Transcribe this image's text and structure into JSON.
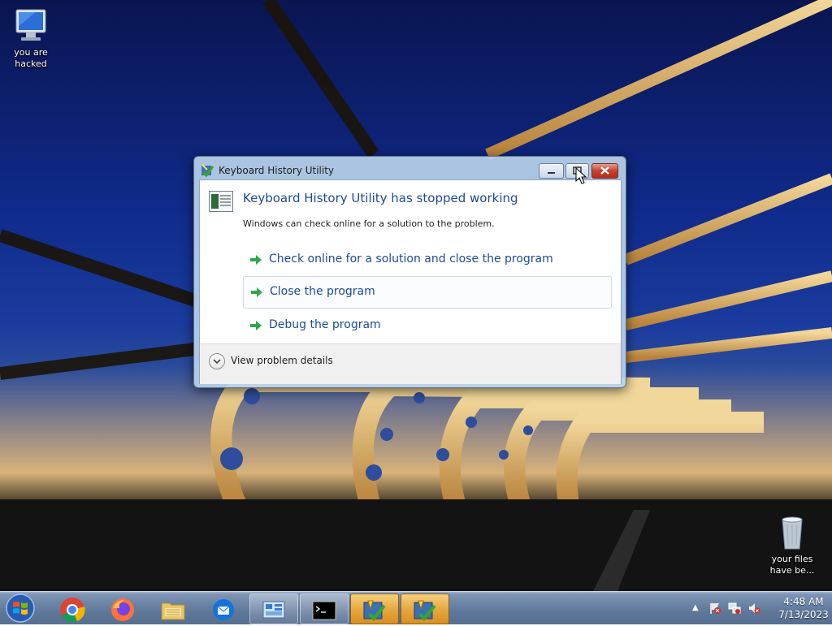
{
  "desktop": {
    "icons": [
      {
        "label": "you are hacked",
        "icon": "computer-icon"
      },
      {
        "label": "your files have be...",
        "icon": "recycle-bin-icon"
      }
    ]
  },
  "dialog": {
    "title": "Keyboard History Utility",
    "heading": "Keyboard History Utility has stopped working",
    "message": "Windows can check online for a solution to the problem.",
    "options": [
      {
        "label": "Check online for a solution and close the program"
      },
      {
        "label": "Close the program"
      },
      {
        "label": "Debug the program"
      }
    ],
    "details_label": "View problem details"
  },
  "taskbar": {
    "items": [
      "windows-start-orb",
      "chrome-icon",
      "firefox-icon",
      "file-explorer-icon",
      "thunderbird-icon",
      "control-panel-icon",
      "command-prompt-icon",
      "error-report-icon",
      "error-report-icon"
    ],
    "clock": {
      "time": "4:48 AM",
      "date": "7/13/2023"
    }
  },
  "colors": {
    "accent": "#1d4a99",
    "taskbar_active": "#e6a63c"
  }
}
